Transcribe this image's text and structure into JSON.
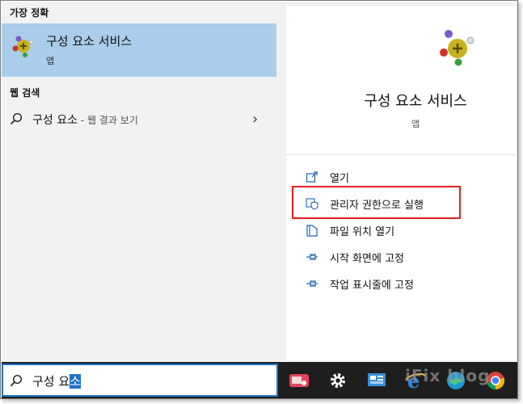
{
  "left": {
    "best_match_header": "가장 정확",
    "best_match": {
      "title": "구성 요소 서비스",
      "subtitle": "앱"
    },
    "web_header": "웹 검색",
    "web_result": {
      "query": "구성 요소",
      "suffix": " - 웹 결과 보기"
    }
  },
  "right": {
    "title": "구성 요소 서비스",
    "subtitle": "앱",
    "actions": [
      {
        "label": "열기",
        "icon": "open-icon"
      },
      {
        "label": "관리자 권한으로 실행",
        "icon": "shield-icon"
      },
      {
        "label": "파일 위치 열기",
        "icon": "file-location-icon"
      },
      {
        "label": "시작 화면에 고정",
        "icon": "pin-icon"
      },
      {
        "label": "작업 표시줄에 고정",
        "icon": "pin-icon"
      }
    ]
  },
  "search": {
    "typed": "구성 요",
    "selected": "소"
  },
  "colors": {
    "highlight": "#a9cdea",
    "accent": "#1f73c8",
    "callout": "#e02020",
    "taskbar": "#1e1e1e"
  },
  "watermark": "iFix blog"
}
